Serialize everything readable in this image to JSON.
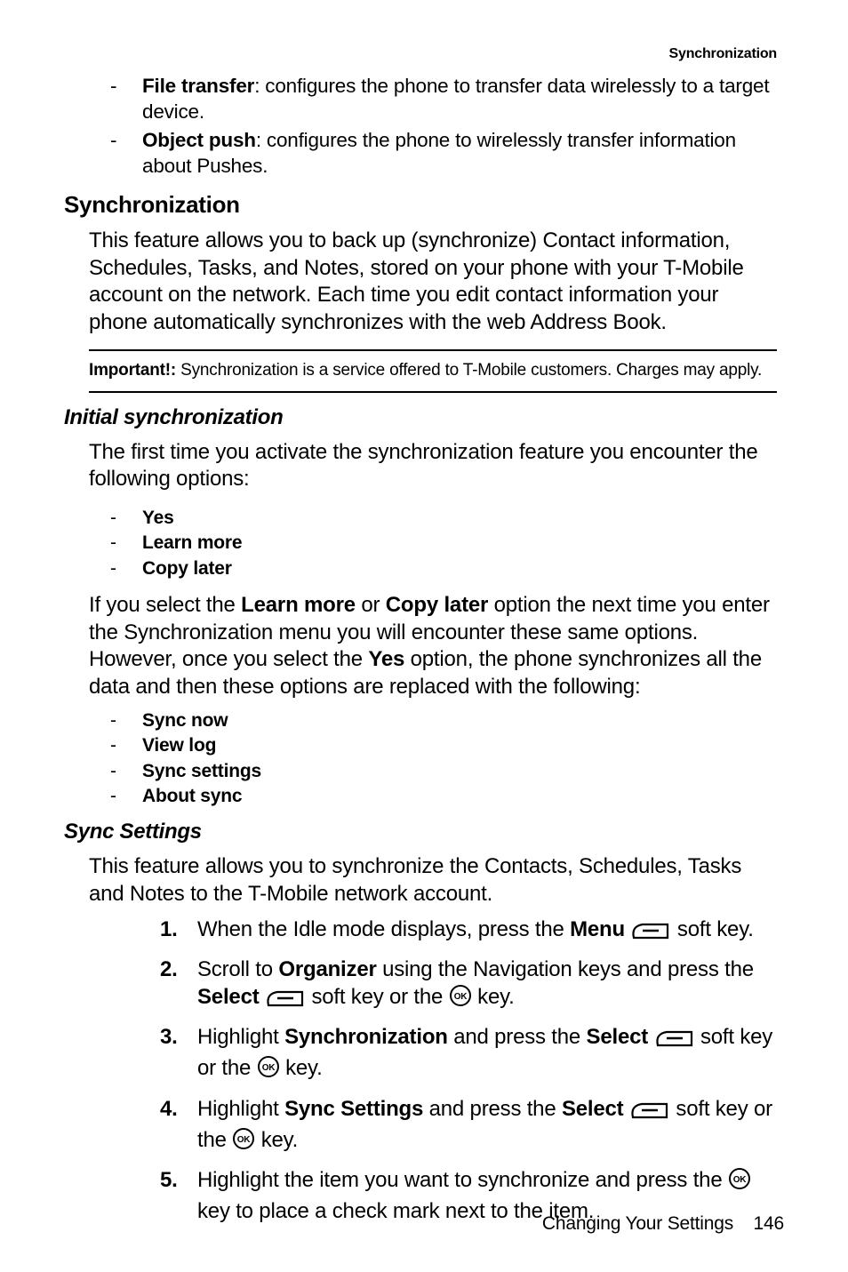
{
  "running_head": "Synchronization",
  "intro_bullets": [
    {
      "term": "File transfer",
      "desc": ": configures the phone to transfer data wirelessly to a target device."
    },
    {
      "term": "Object push",
      "desc": ": configures the phone to wirelessly transfer information about Pushes."
    }
  ],
  "h2": "Synchronization",
  "para1": "This feature allows you to back up (synchronize) Contact information, Schedules, Tasks, and Notes, stored on your phone with your T-Mobile account on the network. Each time you edit contact information your phone automatically synchronizes with the web Address Book.",
  "important": {
    "label": "Important!:",
    "text": " Synchronization is a service offered to T-Mobile customers. Charges may apply."
  },
  "h3a": "Initial synchronization",
  "para2": "The first time you activate the synchronization feature you encounter the following options:",
  "opts1": [
    "Yes",
    "Learn more",
    "Copy later"
  ],
  "para3_parts": {
    "p1": "If you select the ",
    "b1": "Learn more",
    "p2": " or ",
    "b2": "Copy later",
    "p3": " option the next time you enter the Synchronization menu you will encounter these same options. However, once you select the ",
    "b3": "Yes",
    "p4": " option, the phone synchronizes all the data and then these options are replaced with the following:"
  },
  "opts2": [
    "Sync now",
    "View log",
    "Sync settings",
    "About sync"
  ],
  "h3b": "Sync Settings",
  "para4": "This feature allows you to synchronize the Contacts, Schedules, Tasks and Notes to the T-Mobile network account.",
  "steps": {
    "s1": {
      "a": "When the Idle mode displays, press the ",
      "b": "Menu",
      "c": " soft key."
    },
    "s2": {
      "a": "Scroll to ",
      "b": "Organizer",
      "c": " using the Navigation keys and press the ",
      "d": "Select",
      "e": " soft key or the ",
      "f": " key."
    },
    "s3": {
      "a": "Highlight ",
      "b": "Synchronization",
      "c": " and press the ",
      "d": "Select",
      "e": " soft key or the ",
      "f": " key."
    },
    "s4": {
      "a": "Highlight ",
      "b": "Sync Settings",
      "c": " and press the ",
      "d": "Select",
      "e": " soft key or the ",
      "f": " key."
    },
    "s5": {
      "a": "Highlight the item you want to synchronize and press the ",
      "b": " key to place a check mark next to the item."
    }
  },
  "footer": {
    "chapter": "Changing Your Settings",
    "page": "146"
  }
}
